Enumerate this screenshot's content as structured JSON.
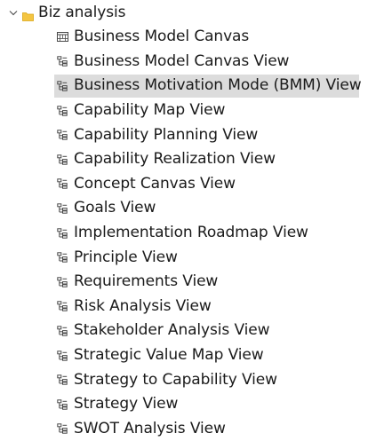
{
  "tree": {
    "root": {
      "label": "Biz analysis",
      "expanded": true,
      "icon": "folder-icon",
      "chevron": "chevron-down-icon"
    },
    "items": [
      {
        "label": "Business Model Canvas",
        "icon": "canvas-icon",
        "selected": false
      },
      {
        "label": "Business Model Canvas View",
        "icon": "view-icon",
        "selected": false
      },
      {
        "label": "Business Motivation Mode (BMM) View",
        "icon": "view-icon",
        "selected": true
      },
      {
        "label": "Capability Map View",
        "icon": "view-icon",
        "selected": false
      },
      {
        "label": "Capability Planning View",
        "icon": "view-icon",
        "selected": false
      },
      {
        "label": "Capability Realization View",
        "icon": "view-icon",
        "selected": false
      },
      {
        "label": "Concept Canvas View",
        "icon": "view-icon",
        "selected": false
      },
      {
        "label": "Goals View",
        "icon": "view-icon",
        "selected": false
      },
      {
        "label": "Implementation Roadmap View",
        "icon": "view-icon",
        "selected": false
      },
      {
        "label": "Principle View",
        "icon": "view-icon",
        "selected": false
      },
      {
        "label": "Requirements View",
        "icon": "view-icon",
        "selected": false
      },
      {
        "label": "Risk Analysis View",
        "icon": "view-icon",
        "selected": false
      },
      {
        "label": "Stakeholder Analysis View",
        "icon": "view-icon",
        "selected": false
      },
      {
        "label": "Strategic Value Map View",
        "icon": "view-icon",
        "selected": false
      },
      {
        "label": "Strategy to Capability View",
        "icon": "view-icon",
        "selected": false
      },
      {
        "label": "Strategy View",
        "icon": "view-icon",
        "selected": false
      },
      {
        "label": "SWOT Analysis View",
        "icon": "view-icon",
        "selected": false
      }
    ]
  },
  "colors": {
    "folder": "#f4c542",
    "folder_edge": "#d9a514",
    "icon_stroke": "#4a4a4a",
    "selection_bg": "#dcdcdc",
    "text": "#1a1a1a"
  }
}
